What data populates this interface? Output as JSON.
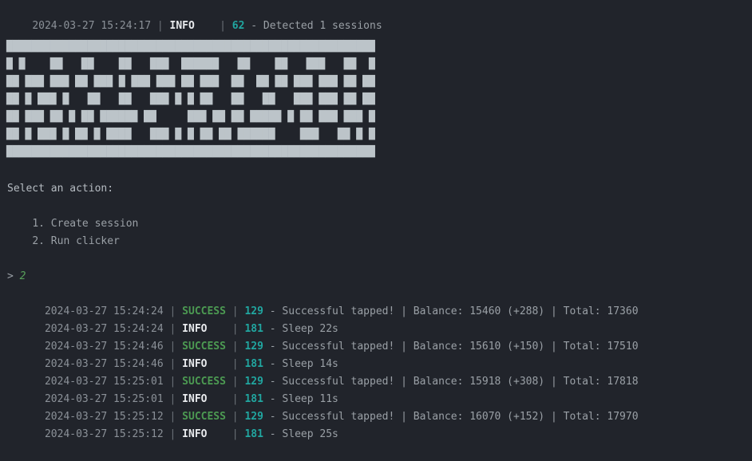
{
  "terminal": {
    "background_color": "#21242b",
    "foreground_color": "#9aa0a6"
  },
  "colors": {
    "timestamp": "#8b9198",
    "pipe": "#6b7177",
    "info": "#e8eaed",
    "success": "#4c9a52",
    "line_number": "#21a6a0",
    "message": "#9aa0a6",
    "prompt_value": "#57a05a",
    "block_art": "#bcc4c9"
  },
  "header_log": {
    "timestamp": "2024-03-27 15:24:17",
    "level": "INFO",
    "level_pad": "   ",
    "line_number": "62",
    "message": "- Detected 1 sessions"
  },
  "block_art": {
    "description": "qr-code-banner",
    "rows": [
      "███████████████████████████████████████████████████████████",
      "█ █    ██   ██    ██   ███  ██████   ██    ██   ███   ██  █",
      "██ ███ ███ ██ ███ █ ███ ███ ██ ███  ██  ██ ██ ███ ███ ██ ██",
      "██ █ ███ █   ██   ██   ███ █ █ ██   ██   ██   ███ ███ ██ ██",
      "██ ███ ██ █ ██ ██████ ██     ███ ██ ██ █████ █ ██ ███ ███ █",
      "██ █ ███ █ ██ █ ████   ███ █ █ ██ ██ ██████    ███   ██ █ █",
      "███████████████████████████████████████████████████████████"
    ]
  },
  "menu": {
    "heading": "Select an action:",
    "items": [
      "1. Create session",
      "2. Run clicker"
    ],
    "indent": "    "
  },
  "prompt": {
    "marker": ">",
    "value": "2"
  },
  "logs": [
    {
      "timestamp": "2024-03-27 15:24:24",
      "level": "SUCCESS",
      "level_type": "success",
      "level_pad": "",
      "line_number": "129",
      "message": "- Successful tapped! | Balance: 15460 (+288) | Total: 17360"
    },
    {
      "timestamp": "2024-03-27 15:24:24",
      "level": "INFO",
      "level_type": "info",
      "level_pad": "   ",
      "line_number": "181",
      "message": "- Sleep 22s"
    },
    {
      "timestamp": "2024-03-27 15:24:46",
      "level": "SUCCESS",
      "level_type": "success",
      "level_pad": "",
      "line_number": "129",
      "message": "- Successful tapped! | Balance: 15610 (+150) | Total: 17510"
    },
    {
      "timestamp": "2024-03-27 15:24:46",
      "level": "INFO",
      "level_type": "info",
      "level_pad": "   ",
      "line_number": "181",
      "message": "- Sleep 14s"
    },
    {
      "timestamp": "2024-03-27 15:25:01",
      "level": "SUCCESS",
      "level_type": "success",
      "level_pad": "",
      "line_number": "129",
      "message": "- Successful tapped! | Balance: 15918 (+308) | Total: 17818"
    },
    {
      "timestamp": "2024-03-27 15:25:01",
      "level": "INFO",
      "level_type": "info",
      "level_pad": "   ",
      "line_number": "181",
      "message": "- Sleep 11s"
    },
    {
      "timestamp": "2024-03-27 15:25:12",
      "level": "SUCCESS",
      "level_type": "success",
      "level_pad": "",
      "line_number": "129",
      "message": "- Successful tapped! | Balance: 16070 (+152) | Total: 17970"
    },
    {
      "timestamp": "2024-03-27 15:25:12",
      "level": "INFO",
      "level_type": "info",
      "level_pad": "   ",
      "line_number": "181",
      "message": "- Sleep 25s"
    }
  ]
}
